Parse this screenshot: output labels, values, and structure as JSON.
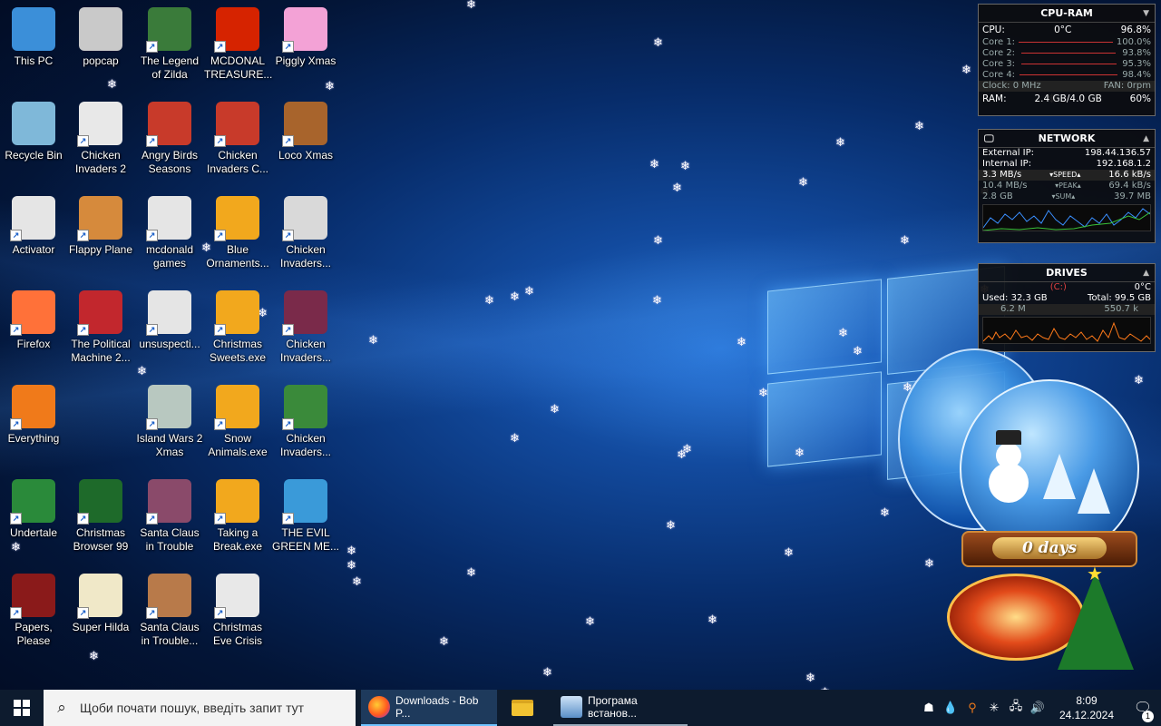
{
  "desktop": {
    "icons": [
      {
        "label": "This PC",
        "icon": "this-pc-icon",
        "color": "#3b8fd9"
      },
      {
        "label": "popcap",
        "icon": "folder-icon",
        "color": "#c9c9c9"
      },
      {
        "label": "The Legend of Zilda",
        "icon": "game-icon",
        "color": "#3a7b3a"
      },
      {
        "label": "MCDONAL TREASURE...",
        "icon": "mcdonalds-icon",
        "color": "#d62300"
      },
      {
        "label": "Piggly Xmas",
        "icon": "pig-icon",
        "color": "#f3a2d6"
      },
      {
        "label": "Recycle Bin",
        "icon": "recycle-bin-icon",
        "color": "#7fb8d9"
      },
      {
        "label": "Chicken Invaders 2",
        "icon": "chicken-icon",
        "color": "#e8e8e8"
      },
      {
        "label": "Angry Birds Seasons",
        "icon": "angry-bird-icon",
        "color": "#c83a2a"
      },
      {
        "label": "Chicken Invaders C...",
        "icon": "chicken-icon",
        "color": "#c83a2a"
      },
      {
        "label": "Loco Xmas",
        "icon": "bear-icon",
        "color": "#a8642c"
      },
      {
        "label": "Activator",
        "icon": "file-icon",
        "color": "#e5e5e5"
      },
      {
        "label": "Flappy Plane",
        "icon": "game-icon",
        "color": "#d68a3c"
      },
      {
        "label": "mcdonald games",
        "icon": "file-icon",
        "color": "#e5e5e5"
      },
      {
        "label": "Blue Ornaments...",
        "icon": "exe-icon",
        "color": "#f2a81d"
      },
      {
        "label": "Chicken Invaders...",
        "icon": "chicken-icon",
        "color": "#d9d9d9"
      },
      {
        "label": "Firefox",
        "icon": "firefox-icon",
        "color": "#ff7139"
      },
      {
        "label": "The Political Machine 2...",
        "icon": "game-icon",
        "color": "#c2272d"
      },
      {
        "label": "unsuspecti...",
        "icon": "file-icon",
        "color": "#e5e5e5"
      },
      {
        "label": "Christmas Sweets.exe",
        "icon": "exe-icon",
        "color": "#f2a81d"
      },
      {
        "label": "Chicken Invaders...",
        "icon": "chicken-icon",
        "color": "#7a2a4a"
      },
      {
        "label": "Everything",
        "icon": "search-icon",
        "color": "#f07a1a"
      },
      {
        "label": "Island Wars 2 Xmas",
        "icon": "game-icon",
        "color": "#b8c8c0"
      },
      {
        "label": "Snow Animals.exe",
        "icon": "exe-icon",
        "color": "#f2a81d"
      },
      {
        "label": "Chicken Invaders...",
        "icon": "chicken-icon",
        "color": "#3a8a3a"
      },
      {
        "label": "Undertale",
        "icon": "undertale-icon",
        "color": "#2a8a3a"
      },
      {
        "label": "Christmas Browser 99",
        "icon": "tree-icon",
        "color": "#1e6a2a"
      },
      {
        "label": "Santa Claus in Trouble",
        "icon": "santa-icon",
        "color": "#8a4a6a"
      },
      {
        "label": "Taking a Break.exe",
        "icon": "exe-icon",
        "color": "#f2a81d"
      },
      {
        "label": "THE EVIL GREEN ME...",
        "icon": "messenger-icon",
        "color": "#3a9ad9"
      },
      {
        "label": "Papers, Please",
        "icon": "papers-please-icon",
        "color": "#8a1a1a"
      },
      {
        "label": "Super Hilda",
        "icon": "game-icon",
        "color": "#f0e8c8"
      },
      {
        "label": "Santa Claus in Trouble...",
        "icon": "santa-icon",
        "color": "#b87a4a"
      },
      {
        "label": "Christmas Eve Crisis",
        "icon": "santa-icon",
        "color": "#e8e8e8"
      }
    ]
  },
  "widgets": {
    "cpu_ram": {
      "title": "CPU-RAM",
      "cpu_label": "CPU:",
      "cpu_temp": "0°C",
      "cpu_load": "96.8%",
      "cores": [
        {
          "label": "Core 1:",
          "value": "100.0%",
          "level": 1.0
        },
        {
          "label": "Core 2:",
          "value": "93.8%",
          "level": 0.938
        },
        {
          "label": "Core 3:",
          "value": "95.3%",
          "level": 0.953
        },
        {
          "label": "Core 4:",
          "value": "98.4%",
          "level": 0.984
        }
      ],
      "clock": "Clock: 0 MHz",
      "fan": "FAN: 0rpm",
      "ram_label": "RAM:",
      "ram_value": "2.4 GB/4.0 GB",
      "ram_percent": "60%"
    },
    "network": {
      "title": "NETWORK",
      "external_label": "External IP:",
      "external_ip": "198.44.136.57",
      "internal_label": "Internal IP:",
      "internal_ip": "192.168.1.2",
      "speed_down": "3.3 MB/s",
      "speed_label": "SPEED",
      "speed_up": "16.6 kB/s",
      "peak_down": "10.4 MB/s",
      "peak_label": "PEAK",
      "peak_up": "69.4 kB/s",
      "sum_down": "2.8 GB",
      "sum_label": "SUM",
      "sum_up": "39.7 MB"
    },
    "drives": {
      "title": "DRIVES",
      "drive_letter": "(C:)",
      "drive_temp": "0°C",
      "used": "Used: 32.3 GB",
      "total": "Total: 99.5 GB",
      "read": "6.2 M",
      "write": "550.7 k"
    }
  },
  "snowglobe": {
    "plaque": "0 days"
  },
  "taskbar": {
    "search_placeholder": "Щоби почати пошук, введіть запит тут",
    "apps": [
      {
        "label": "Downloads - Bob P...",
        "icon": "firefox-icon",
        "state": "active"
      },
      {
        "label": "",
        "icon": "file-explorer-icon",
        "state": "pinned"
      },
      {
        "label": "Програма встанов...",
        "icon": "installer-icon",
        "state": "running"
      }
    ],
    "tray": {
      "icons": [
        "network-people-icon",
        "droplet-icon",
        "search-magnifier-icon",
        "snowflake-icon",
        "network-icon",
        "volume-icon"
      ],
      "time": "8:09",
      "date": "24.12.2024",
      "notifications": "1"
    }
  }
}
